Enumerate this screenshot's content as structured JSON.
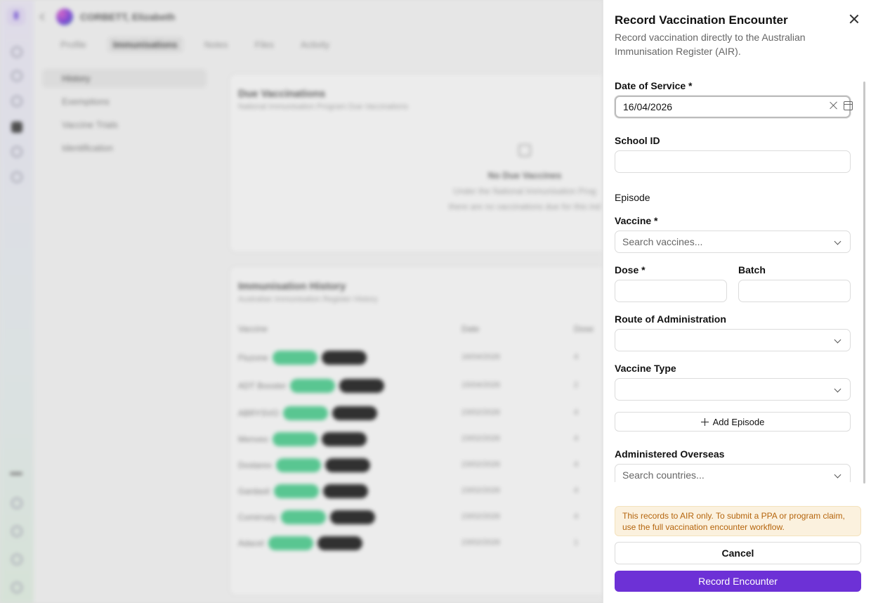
{
  "background": {
    "patient_name": "CORBETT, Elizabeth",
    "tabs": [
      "Profile",
      "Immunisations",
      "Notes",
      "Files",
      "Activity"
    ],
    "sidebar": [
      "History",
      "Exemptions",
      "Vaccine Trials",
      "Identification"
    ],
    "due_card": {
      "title": "Due Vaccinations",
      "subtitle": "National Immunisation Program Due Vaccinations",
      "empty_title": "No Due Vaccines",
      "empty_text_1": "Under the National Immunisation Prog",
      "empty_text_2": "there are no vaccinations due for this ind"
    },
    "history_card": {
      "title": "Immunisation History",
      "subtitle": "Australian Immunisation Register History",
      "headers": [
        "Vaccine",
        "Date",
        "Dose"
      ],
      "rows": [
        {
          "vaccine": "Fluzone",
          "date": "16/04/2026",
          "dose": "4"
        },
        {
          "vaccine": "ADT Booster",
          "date": "15/04/2026",
          "dose": "2"
        },
        {
          "vaccine": "ABRYSVO",
          "date": "23/02/2026",
          "dose": "4"
        },
        {
          "vaccine": "Menveo",
          "date": "23/02/2026",
          "dose": "4"
        },
        {
          "vaccine": "Dostarex",
          "date": "23/02/2026",
          "dose": "4"
        },
        {
          "vaccine": "Gardasil",
          "date": "23/02/2026",
          "dose": "4"
        },
        {
          "vaccine": "Comirnaty",
          "date": "23/02/2026",
          "dose": "4"
        },
        {
          "vaccine": "Adacel",
          "date": "23/02/2026",
          "dose": "1"
        }
      ]
    }
  },
  "drawer": {
    "title": "Record Vaccination Encounter",
    "description": "Record vaccination directly to the Australian Immunisation Register (AIR).",
    "date_of_service": {
      "label": "Date of Service *",
      "value": "16/04/2026"
    },
    "school_id": {
      "label": "School ID",
      "value": "",
      "placeholder": ""
    },
    "episode_heading": "Episode",
    "vaccine": {
      "label": "Vaccine *",
      "placeholder": "Search vaccines..."
    },
    "dose": {
      "label": "Dose *",
      "value": ""
    },
    "batch": {
      "label": "Batch",
      "value": ""
    },
    "route": {
      "label": "Route of Administration",
      "value": ""
    },
    "vaccine_type": {
      "label": "Vaccine Type",
      "value": ""
    },
    "add_episode": "Add Episode",
    "overseas": {
      "label": "Administered Overseas",
      "placeholder": "Search countries..."
    },
    "notice": "This records to AIR only. To submit a PPA or program claim, use the full vaccination encounter workflow.",
    "cancel": "Cancel",
    "submit": "Record Encounter"
  },
  "colors": {
    "primary": "#6d31d6",
    "notice_bg": "#fbf1de",
    "notice_text": "#b5650d"
  }
}
